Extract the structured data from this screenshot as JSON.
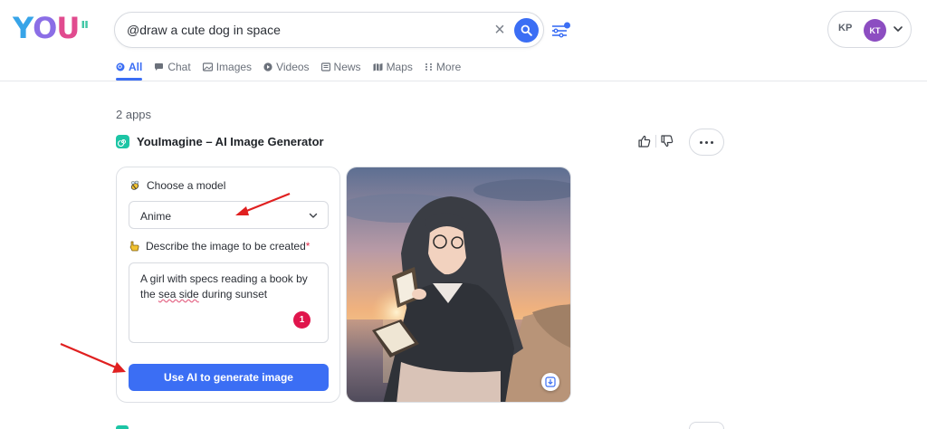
{
  "logo": {
    "text_1": "Y",
    "text_2": "O",
    "text_3": "U",
    "mark": "ıı"
  },
  "search": {
    "query": "@draw a cute dog in space",
    "clear_label": "×"
  },
  "account": {
    "initials_1": "KP",
    "initials_2": "KT"
  },
  "tabs": [
    {
      "label": "All",
      "icon": "search-icon",
      "active": true
    },
    {
      "label": "Chat",
      "icon": "chat-icon",
      "active": false
    },
    {
      "label": "Images",
      "icon": "image-icon",
      "active": false
    },
    {
      "label": "Videos",
      "icon": "play-icon",
      "active": false
    },
    {
      "label": "News",
      "icon": "news-icon",
      "active": false
    },
    {
      "label": "Maps",
      "icon": "map-icon",
      "active": false
    },
    {
      "label": "More",
      "icon": "grid-dots-icon",
      "active": false
    }
  ],
  "main": {
    "apps_count": "2 apps",
    "app_title": "YouImagine – AI Image Generator"
  },
  "form": {
    "model_label": "Choose a model",
    "model_value": "Anime",
    "describe_label": "Describe the image to be created",
    "required_mark": "*",
    "prompt_part1": "A girl with specs reading a book by the ",
    "prompt_underlined": "sea side",
    "prompt_part2": " during sunset",
    "badge": "1",
    "generate_label": "Use AI to generate image"
  },
  "colors": {
    "accent": "#3b6ef4",
    "badge": "#e0154c",
    "arrow": "#e02020",
    "app_icon": "#1cc5a5"
  }
}
